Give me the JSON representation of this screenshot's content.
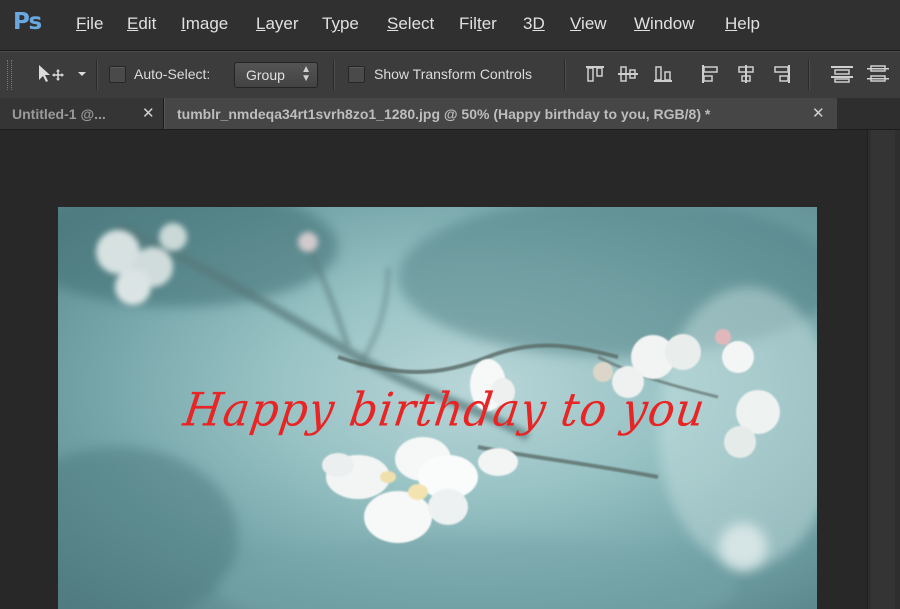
{
  "app": {
    "logo": "Ps"
  },
  "menu": [
    {
      "label": "File",
      "u": "F",
      "rest": "ile"
    },
    {
      "label": "Edit",
      "u": "E",
      "rest": "dit"
    },
    {
      "label": "Image",
      "u": "I",
      "rest": "mage"
    },
    {
      "label": "Layer",
      "u": "L",
      "rest": "ayer"
    },
    {
      "label": "Type",
      "u": "Y",
      "rest": "pe"
    },
    {
      "label": "Select",
      "u": "S",
      "rest": "elect"
    },
    {
      "label": "Filter",
      "u": "T",
      "rest": "er"
    },
    {
      "label": "3D",
      "u": "D",
      "rest": ""
    },
    {
      "label": "View",
      "u": "V",
      "rest": "iew"
    },
    {
      "label": "Window",
      "u": "W",
      "rest": "indow"
    },
    {
      "label": "Help",
      "u": "H",
      "rest": "elp"
    }
  ],
  "options": {
    "auto_select_label": "Auto-Select:",
    "auto_select_checked": false,
    "target_select_value": "Group",
    "show_transform_label": "Show Transform Controls",
    "show_transform_checked": false
  },
  "tabs": [
    {
      "label": "Untitled-1 @...",
      "active": false
    },
    {
      "label": "tumblr_nmdeqa34rt1svrh8zo1_1280.jpg @ 50% (Happy birthday to you, RGB/8) *",
      "active": true
    }
  ],
  "document": {
    "text_layer": "Happy birthday to you",
    "text_color": "#e82424"
  },
  "colors": {
    "logo_blue": "#6aa9e0",
    "menubar_bg": "#303030",
    "options_bg": "#3c3c3c",
    "canvas_bg": "#282828"
  },
  "icons": {
    "move_tool": "move-tool-icon",
    "dropdown": "chevron-down-icon",
    "align_top": "align-top-edges-icon",
    "align_vcenter": "align-vertical-centers-icon",
    "align_bottom": "align-bottom-edges-icon",
    "align_left": "align-left-edges-icon",
    "align_hcenter": "align-horizontal-centers-icon",
    "align_right": "align-right-edges-icon",
    "distribute_top": "distribute-top-edges-icon",
    "distribute_vcenter": "distribute-vertical-centers-icon"
  }
}
